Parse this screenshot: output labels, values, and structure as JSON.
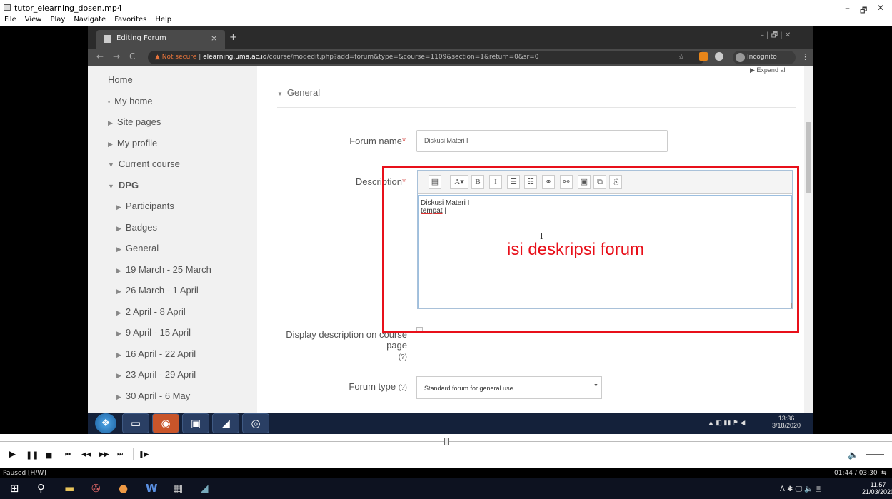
{
  "window": {
    "title": "tutor_elearning_dosen.mp4",
    "minimize": "–",
    "maximize": "🗗",
    "close": "✕"
  },
  "menubar": [
    "File",
    "View",
    "Play",
    "Navigate",
    "Favorites",
    "Help"
  ],
  "browser": {
    "tab_title": "Editing Forum",
    "tab_close": "×",
    "new_tab": "+",
    "win_buttons": "– | 🗗 | ✕",
    "nav_back": "←",
    "nav_forward": "→",
    "nav_reload": "C",
    "security_label": "Not secure",
    "url_host": "elearning.uma.ac.id",
    "url_path": "/course/modedit.php?add=forum&type=&course=1109&section=1&return=0&sr=0",
    "incognito_label": "Incognito",
    "star_icon": "☆",
    "menu_icon": "⋮"
  },
  "sidebar": {
    "items": [
      {
        "label": "Home",
        "marker": ""
      },
      {
        "label": "My home",
        "marker": "•"
      },
      {
        "label": "Site pages",
        "marker": "▶"
      },
      {
        "label": "My profile",
        "marker": "▶"
      },
      {
        "label": "Current course",
        "marker": "▼"
      },
      {
        "label": "DPG",
        "marker": "▼"
      },
      {
        "label": "Participants",
        "marker": "▶"
      },
      {
        "label": "Badges",
        "marker": "▶"
      },
      {
        "label": "General",
        "marker": "▶"
      },
      {
        "label": "19 March - 25 March",
        "marker": "▶"
      },
      {
        "label": "26 March - 1 April",
        "marker": "▶"
      },
      {
        "label": "2 April - 8 April",
        "marker": "▶"
      },
      {
        "label": "9 April - 15 April",
        "marker": "▶"
      },
      {
        "label": "16 April - 22 April",
        "marker": "▶"
      },
      {
        "label": "23 April - 29 April",
        "marker": "▶"
      },
      {
        "label": "30 April - 6 May",
        "marker": "▶"
      }
    ]
  },
  "form": {
    "expand_all": "▶ Expand all",
    "section_marker": "▼",
    "section_title": "General",
    "forum_name_label": "Forum name",
    "required_mark": "*",
    "forum_name_value": "Diskusi Materi I",
    "description_label": "Description",
    "description_line1": "Diskusi Materi I",
    "description_line2": "tempat",
    "display_desc_label_1": "Display description on course",
    "display_desc_label_2": "page",
    "help_icon": "?",
    "forum_type_label": "Forum type",
    "forum_type_value": "Standard forum for general use",
    "select_caret": "▼"
  },
  "toolbar": [
    "▤",
    "A▾",
    "B",
    "I",
    "☰",
    "☷",
    "⚭",
    "⚯",
    "▣",
    "⧉",
    "⎘"
  ],
  "annotation": {
    "text": "isi deskripsi forum",
    "color": "#e8101a"
  },
  "win7_taskbar": {
    "clock_time": "13:36",
    "clock_date": "3/18/2020",
    "tray": "▲ ◧ ▮▮ ⚑ ◀"
  },
  "player": {
    "buttons": [
      "▶",
      "❚❚",
      "■",
      "⏮",
      "◀◀",
      "▶▶",
      "⏭",
      "❚▶"
    ],
    "volume_icon": "🔈"
  },
  "status": {
    "left": "Paused [H/W]",
    "right": "01:44 / 03:30",
    "right_icon": "⇆"
  },
  "taskbar": {
    "icons": [
      "⊞",
      "⚲",
      "▬",
      "✇",
      "●",
      "W",
      "▦",
      "◢"
    ],
    "tray": "ᐱ ✱ 🖵 🔈 🗏",
    "clock_time": "11.57",
    "clock_date": "21/03/2020"
  },
  "colors": {
    "annotation_red": "#e8101a",
    "required_red": "#d9534f",
    "browser_dark": "#2b2b2b"
  }
}
